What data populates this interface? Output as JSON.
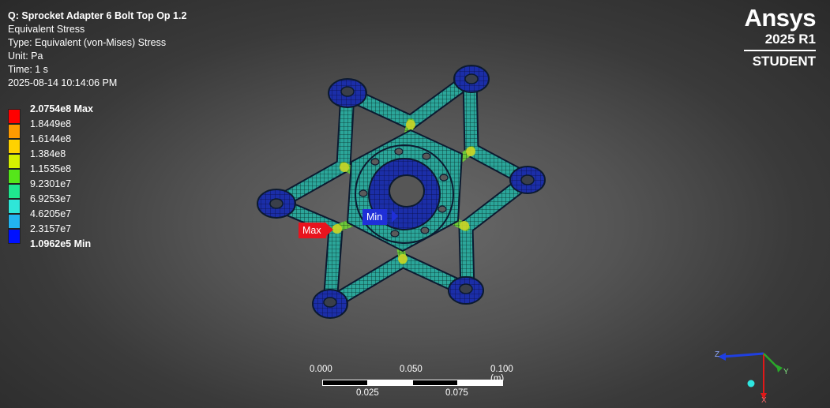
{
  "header": {
    "title": "Q: Sprocket Adapter 6 Bolt Top Op 1.2",
    "result": "Equivalent Stress",
    "type": "Type: Equivalent (von-Mises) Stress",
    "unit": "Unit: Pa",
    "time": "Time: 1 s",
    "timestamp": "2025-08-14 10:14:06 PM"
  },
  "legend": [
    {
      "label": "2.0754e8 Max",
      "color": "#ff0000",
      "bold": true
    },
    {
      "label": "1.8449e8",
      "color": "#ff9a00"
    },
    {
      "label": "1.6144e8",
      "color": "#ffd200"
    },
    {
      "label": "1.384e8",
      "color": "#d6f000"
    },
    {
      "label": "1.1535e8",
      "color": "#55e61a"
    },
    {
      "label": "9.2301e7",
      "color": "#1fe68f"
    },
    {
      "label": "6.9253e7",
      "color": "#2fe6d8"
    },
    {
      "label": "4.6205e7",
      "color": "#22b4f0"
    },
    {
      "label": "2.3157e7",
      "color": "#1060ff"
    },
    {
      "label": "1.0962e5 Min",
      "color": "#0010ff",
      "bold": true
    }
  ],
  "brand": {
    "name": "Ansys",
    "version": "2025 R1",
    "edition": "STUDENT"
  },
  "probes": {
    "max_label": "Max",
    "min_label": "Min"
  },
  "scale_bar": {
    "top_labels": [
      "0.000",
      "0.050",
      "0.100 (m)"
    ],
    "bottom_labels": [
      "0.025",
      "0.075"
    ]
  },
  "triad": {
    "z": "Z",
    "y": "Y",
    "x": "X"
  },
  "colors": {
    "mesh_blue": "#1a3dbb",
    "mesh_teal": "#25a89c",
    "mesh_green": "#4cc24c",
    "mesh_yellow": "#c8d42a"
  }
}
